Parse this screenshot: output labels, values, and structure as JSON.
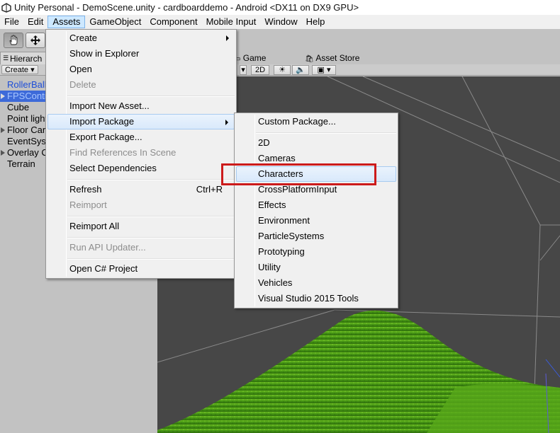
{
  "window": {
    "title": "Unity Personal - DemoScene.unity - cardboarddemo - Android <DX11 on DX9 GPU>"
  },
  "menubar": [
    "File",
    "Edit",
    "Assets",
    "GameObject",
    "Component",
    "Mobile Input",
    "Window",
    "Help"
  ],
  "hierarchy": {
    "tab_label": "Hierarch",
    "create_label": "Create",
    "items": [
      {
        "label": "RollerBall"
      },
      {
        "label": "FPSContr"
      },
      {
        "label": "Cube"
      },
      {
        "label": "Point light"
      },
      {
        "label": "Floor Car"
      },
      {
        "label": "EventSys"
      },
      {
        "label": "Overlay C"
      },
      {
        "label": "Terrain"
      }
    ]
  },
  "scene": {
    "game_tab": "Game",
    "asset_store_tab": "Asset Store",
    "mode_2d": "2D"
  },
  "assets_menu": [
    {
      "label": "Create"
    },
    {
      "label": "Show in Explorer"
    },
    {
      "label": "Open"
    },
    {
      "label": "Delete"
    },
    {
      "label": "Import New Asset..."
    },
    {
      "label": "Import Package"
    },
    {
      "label": "Export Package..."
    },
    {
      "label": "Find References In Scene"
    },
    {
      "label": "Select Dependencies"
    },
    {
      "label": "Refresh",
      "shortcut": "Ctrl+R"
    },
    {
      "label": "Reimport"
    },
    {
      "label": "Reimport All"
    },
    {
      "label": "Run API Updater..."
    },
    {
      "label": "Open C# Project"
    }
  ],
  "import_package_menu": [
    {
      "label": "Custom Package..."
    },
    {
      "label": "2D"
    },
    {
      "label": "Cameras"
    },
    {
      "label": "Characters"
    },
    {
      "label": "CrossPlatformInput"
    },
    {
      "label": "Effects"
    },
    {
      "label": "Environment"
    },
    {
      "label": "ParticleSystems"
    },
    {
      "label": "Prototyping"
    },
    {
      "label": "Utility"
    },
    {
      "label": "Vehicles"
    },
    {
      "label": "Visual Studio 2015 Tools"
    }
  ]
}
